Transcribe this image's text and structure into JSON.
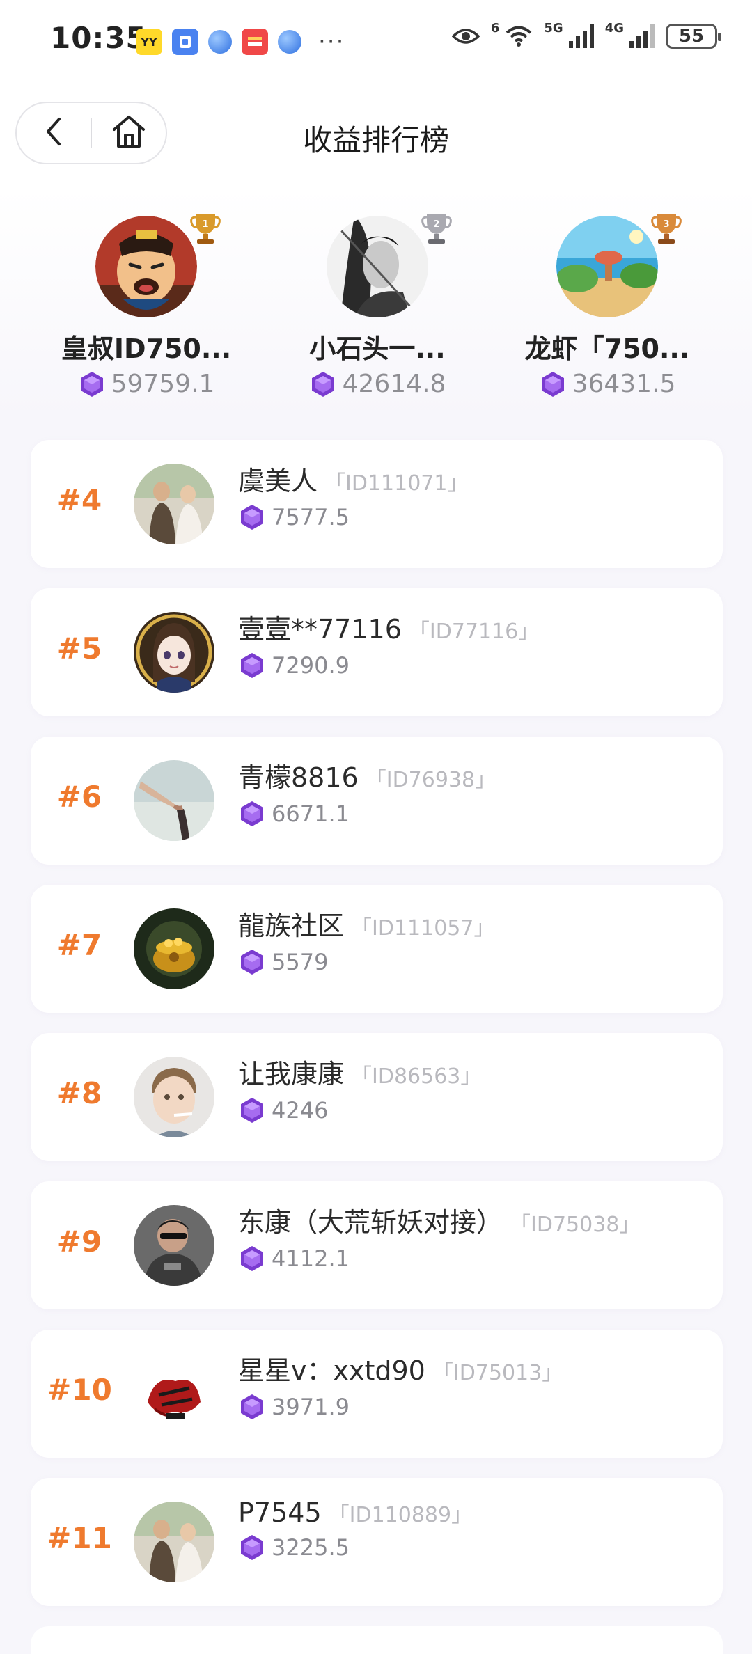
{
  "status_bar": {
    "time": "10:35",
    "app_yy_label": "YY",
    "more_label": "···",
    "net_5g": "5G",
    "net_4g": "4G",
    "net_6": "6",
    "battery": "55"
  },
  "nav": {
    "title": "收益排行榜"
  },
  "podium": [
    {
      "rank": "1",
      "name": "皇叔ID750...",
      "score": "59759.1",
      "trophy_color": "#d99a2b"
    },
    {
      "rank": "2",
      "name": "小石头一...",
      "score": "42614.8",
      "trophy_color": "#a9a9b0"
    },
    {
      "rank": "3",
      "name": "龙虾「750...",
      "score": "36431.5",
      "trophy_color": "#d98a3a"
    }
  ],
  "list": [
    {
      "rank": "#4",
      "name": "虞美人",
      "uid": "「ID111071」",
      "score": "7577.5"
    },
    {
      "rank": "#5",
      "name": "壹壹**77116",
      "uid": "「ID77116」",
      "score": "7290.9"
    },
    {
      "rank": "#6",
      "name": "青檬8816",
      "uid": "「ID76938」",
      "score": "6671.1"
    },
    {
      "rank": "#7",
      "name": "龍族社区",
      "uid": "「ID111057」",
      "score": "5579"
    },
    {
      "rank": "#8",
      "name": "让我康康",
      "uid": "「ID86563」",
      "score": "4246"
    },
    {
      "rank": "#9",
      "name": "东康（大荒斩妖对接）",
      "uid": "「ID75038」",
      "score": "4112.1"
    },
    {
      "rank": "#10",
      "name": "星星v：xxtd90",
      "uid": "「ID75013」",
      "score": "3971.9"
    },
    {
      "rank": "#11",
      "name": "P7545",
      "uid": "「ID110889」",
      "score": "3225.5"
    }
  ],
  "colors": {
    "rank_orange": "#ef7a2e",
    "gem_purple": "#8a4dd8",
    "background": "#f7f6fb"
  },
  "icons": {
    "back": "chevron-left-icon",
    "home": "home-icon",
    "gem": "purple-gem-icon",
    "trophy": "trophy-icon"
  }
}
